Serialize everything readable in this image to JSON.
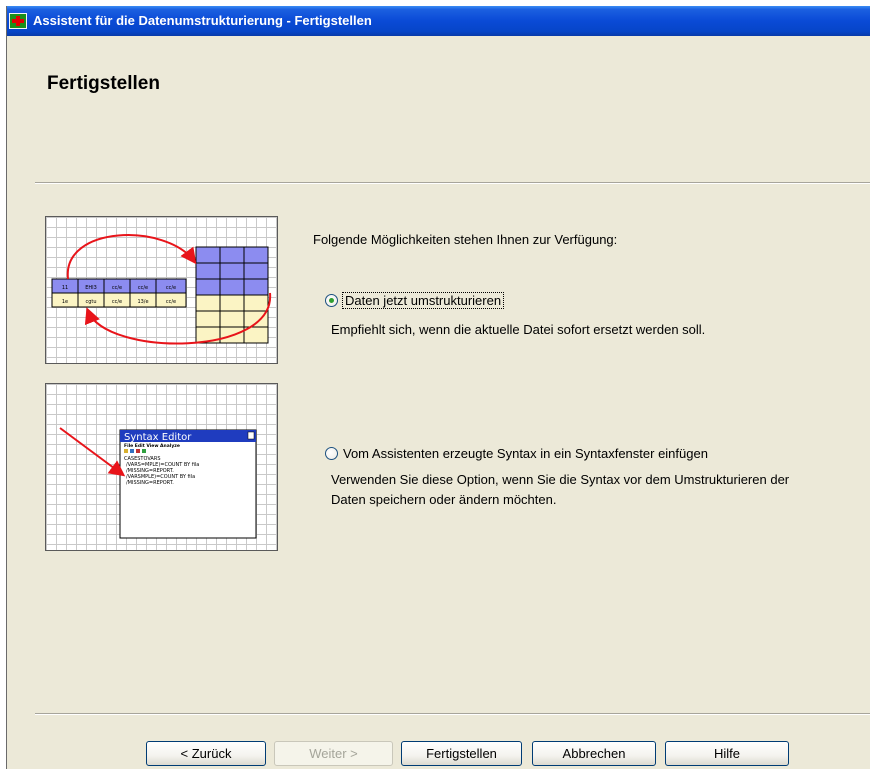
{
  "window": {
    "title": "Assistent für die Datenumstrukturierung - Fertigstellen"
  },
  "header": {
    "title": "Fertigstellen"
  },
  "thumbnails": {
    "restructure_table_cells": [
      "11",
      "EHI3",
      "cc/e",
      "cc/e",
      "cc/e",
      "1e",
      "cgtu",
      "cc/e",
      "13/e",
      "cc/e"
    ],
    "syntax_editor": {
      "title": "Syntax Editor",
      "menu": "File  Edit  View  Analyze",
      "lines": [
        "CASESTOVARS",
        "/VARS=MPLE)=COUNT BY fila",
        "/MISSING=REPORT.",
        "/VARSMPLE)=COUNT BY fila",
        "/MISSING=REPORT."
      ]
    }
  },
  "content": {
    "intro": "Folgende Möglichkeiten stehen Ihnen zur Verfügung:",
    "options": [
      {
        "label": "Daten jetzt umstrukturieren",
        "description_lines": [
          "Empfiehlt sich, wenn die aktuelle Datei sofort ersetzt werden soll."
        ],
        "selected": true
      },
      {
        "label": "Vom Assistenten erzeugte Syntax in ein Syntaxfenster einfügen",
        "description_lines": [
          "Verwenden Sie diese Option, wenn Sie die Syntax vor dem Umstrukturieren der",
          "Daten speichern oder ändern möchten."
        ],
        "selected": false
      }
    ]
  },
  "buttons": {
    "back": "< Zurück",
    "next": "Weiter >",
    "finish": "Fertigstellen",
    "cancel": "Abbrechen",
    "help": "Hilfe"
  },
  "colors": {
    "titlebar": "#0a4ad6",
    "dialog_bg": "#ece9d8",
    "table_header_cell": "#8c8cf0",
    "table_data_cell": "#fbf4c4",
    "arrow": "#e8141a",
    "syntax_title": "#1f3cbf"
  }
}
